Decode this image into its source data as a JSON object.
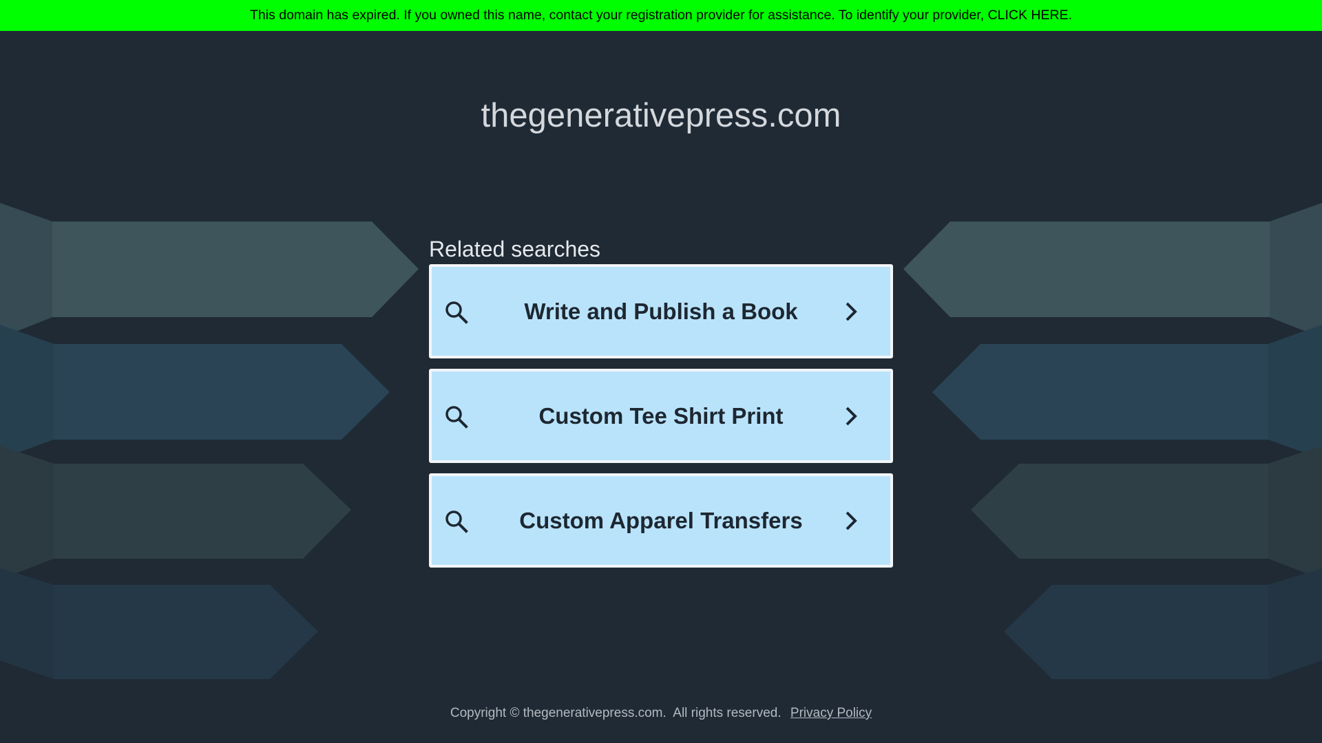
{
  "banner": {
    "text": "This domain has expired. If you owned this name, contact your registration provider for assistance. To identify your provider, CLICK HERE.",
    "color": "#00ff00"
  },
  "domain_title": "thegenerativepress.com",
  "related": {
    "heading": "Related searches",
    "items": [
      {
        "label": "Write and Publish a Book",
        "icon": "search-icon",
        "arrow": "chevron-right-icon"
      },
      {
        "label": "Custom Tee Shirt Print",
        "icon": "search-icon",
        "arrow": "chevron-right-icon"
      },
      {
        "label": "Custom Apparel Transfers",
        "icon": "search-icon",
        "arrow": "chevron-right-icon"
      }
    ]
  },
  "footer": {
    "copyright": "Copyright © thegenerativepress.com.  All rights reserved.",
    "privacy_label": "Privacy Policy"
  },
  "colors": {
    "background": "#1f2a35",
    "card": "#b9e3fb",
    "card_border": "#f2f5f7"
  }
}
